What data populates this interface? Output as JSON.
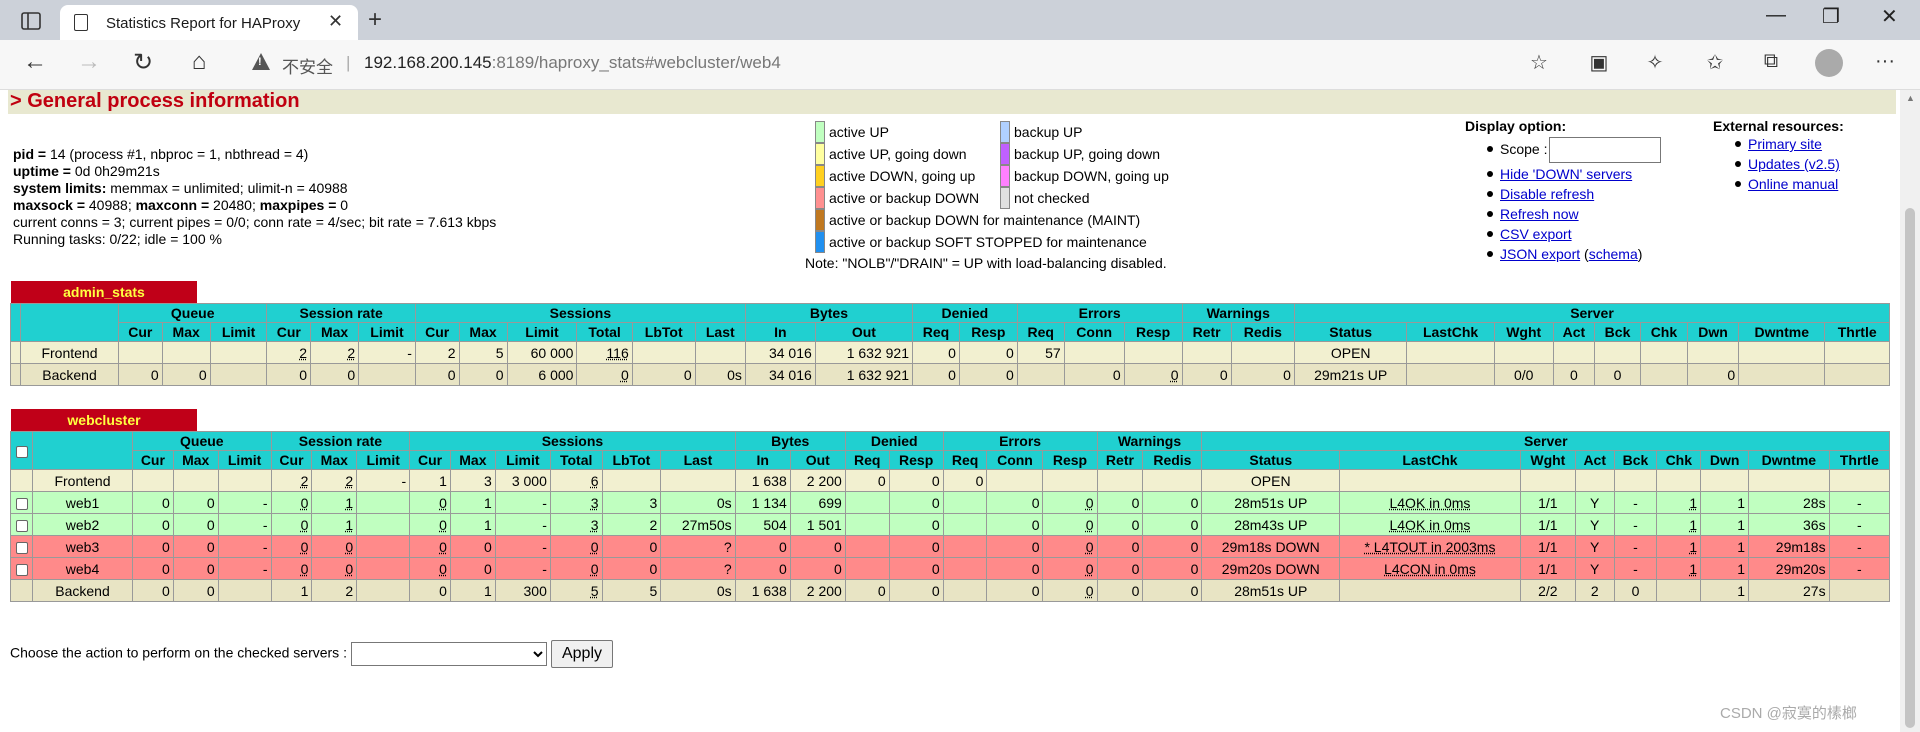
{
  "browser": {
    "tab_title": "Statistics Report for HAProxy",
    "insecure_label": "不安全",
    "url_host": "192.168.200.145",
    "url_rest": ":8189/haproxy_stats#webcluster/web4"
  },
  "page": {
    "section_title": "> General process information",
    "info": {
      "pid_label": "pid = ",
      "pid_value": "14 (process #1, nbproc = 1, nbthread = 4)",
      "uptime_label": "uptime = ",
      "uptime_value": "0d 0h29m21s",
      "limits_label": "system limits:",
      "limits_value": " memmax = unlimited; ulimit-n = 40988",
      "maxsock_label": "maxsock = ",
      "maxsock_value": "40988; ",
      "maxconn_label": "maxconn = ",
      "maxconn_value": "20480; ",
      "maxpipes_label": "maxpipes = ",
      "maxpipes_value": "0",
      "conns_line": "current conns = 3; current pipes = 0/0; conn rate = 4/sec; bit rate = 7.613 kbps",
      "tasks_line": "Running tasks: 0/22; idle = 100 %"
    },
    "legend": [
      {
        "label": "active UP",
        "color": "#c0ffc0"
      },
      {
        "label": "backup UP",
        "color": "#b0d0ff"
      },
      {
        "label": "active UP, going down",
        "color": "#ffffa0"
      },
      {
        "label": "backup UP, going down",
        "color": "#c060ff"
      },
      {
        "label": "active DOWN, going up",
        "color": "#ffd020"
      },
      {
        "label": "backup DOWN, going up",
        "color": "#ff80ff"
      },
      {
        "label": "active or backup DOWN",
        "color": "#ff9090"
      },
      {
        "label": "not checked",
        "color": "#e0e0e0"
      },
      {
        "label": "active or backup DOWN for maintenance (MAINT)",
        "color": "#c07820"
      },
      {
        "label": "active or backup SOFT STOPPED for maintenance",
        "color": "#2090f0"
      }
    ],
    "note": "Note: \"NOLB\"/\"DRAIN\" = UP with load-balancing disabled.",
    "display": {
      "title": "Display option:",
      "scope_label": "Scope :",
      "scope_value": "",
      "links": [
        "Hide 'DOWN' servers",
        "Disable refresh",
        "Refresh now",
        "CSV export",
        "JSON export"
      ],
      "schema_pre": " (",
      "schema": "schema",
      "schema_post": ")"
    },
    "external": {
      "title": "External resources:",
      "links": [
        "Primary site",
        "Updates (v2.5)",
        "Online manual"
      ]
    },
    "admin_stats": {
      "name": "admin_stats",
      "groups": [
        "Queue",
        "Session rate",
        "Sessions",
        "Bytes",
        "Denied",
        "Errors",
        "Warnings",
        "Server"
      ],
      "cols": [
        "Cur",
        "Max",
        "Limit",
        "Cur",
        "Max",
        "Limit",
        "Cur",
        "Max",
        "Limit",
        "Total",
        "LbTot",
        "Last",
        "In",
        "Out",
        "Req",
        "Resp",
        "Req",
        "Conn",
        "Resp",
        "Retr",
        "Redis",
        "Status",
        "LastChk",
        "Wght",
        "Act",
        "Bck",
        "Chk",
        "Dwn",
        "Dwntme",
        "Thrtle"
      ],
      "rows": [
        {
          "name": "Frontend",
          "cells": [
            "",
            "",
            "",
            "2",
            "2",
            "-",
            "2",
            "5",
            "60 000",
            "116",
            "",
            "",
            "34 016",
            "1 632 921",
            "0",
            "0",
            "57",
            "",
            "",
            "",
            "",
            "OPEN",
            "",
            "",
            "",
            "",
            "",
            "",
            "",
            ""
          ]
        },
        {
          "name": "Backend",
          "cells": [
            "0",
            "0",
            "",
            "0",
            "0",
            "",
            "0",
            "0",
            "6 000",
            "0",
            "0",
            "0s",
            "34 016",
            "1 632 921",
            "0",
            "0",
            "",
            "0",
            "0",
            "0",
            "0",
            "29m21s UP",
            "",
            "0/0",
            "0",
            "0",
            "",
            "0",
            "",
            ""
          ]
        }
      ]
    },
    "webcluster": {
      "name": "webcluster",
      "groups": [
        "Queue",
        "Session rate",
        "Sessions",
        "Bytes",
        "Denied",
        "Errors",
        "Warnings",
        "Server"
      ],
      "cols": [
        "Cur",
        "Max",
        "Limit",
        "Cur",
        "Max",
        "Limit",
        "Cur",
        "Max",
        "Limit",
        "Total",
        "LbTot",
        "Last",
        "In",
        "Out",
        "Req",
        "Resp",
        "Req",
        "Conn",
        "Resp",
        "Retr",
        "Redis",
        "Status",
        "LastChk",
        "Wght",
        "Act",
        "Bck",
        "Chk",
        "Dwn",
        "Dwntme",
        "Thrtle"
      ],
      "rows": [
        {
          "name": "Frontend",
          "kind": "front",
          "cells": [
            "",
            "",
            "",
            "2",
            "2",
            "-",
            "1",
            "3",
            "3 000",
            "6",
            "",
            "",
            "1 638",
            "2 200",
            "0",
            "0",
            "0",
            "",
            "",
            "",
            "",
            "OPEN",
            "",
            "",
            "",
            "",
            "",
            "",
            "",
            ""
          ]
        },
        {
          "name": "web1",
          "kind": "up",
          "cells": [
            "0",
            "0",
            "-",
            "0",
            "1",
            "",
            "0",
            "1",
            "-",
            "3",
            "3",
            "0s",
            "1 134",
            "699",
            "",
            "0",
            "",
            "0",
            "0",
            "0",
            "0",
            "28m51s UP",
            "L4OK in 0ms",
            "1/1",
            "Y",
            "-",
            "1",
            "1",
            "28s",
            "-"
          ]
        },
        {
          "name": "web2",
          "kind": "up",
          "cells": [
            "0",
            "0",
            "-",
            "0",
            "1",
            "",
            "0",
            "1",
            "-",
            "3",
            "2",
            "27m50s",
            "504",
            "1 501",
            "",
            "0",
            "",
            "0",
            "0",
            "0",
            "0",
            "28m43s UP",
            "L4OK in 0ms",
            "1/1",
            "Y",
            "-",
            "1",
            "1",
            "36s",
            "-"
          ]
        },
        {
          "name": "web3",
          "kind": "down",
          "cells": [
            "0",
            "0",
            "-",
            "0",
            "0",
            "",
            "0",
            "0",
            "-",
            "0",
            "0",
            "?",
            "0",
            "0",
            "",
            "0",
            "",
            "0",
            "0",
            "0",
            "0",
            "29m18s DOWN",
            "* L4TOUT in 2003ms",
            "1/1",
            "Y",
            "-",
            "1",
            "1",
            "29m18s",
            "-"
          ]
        },
        {
          "name": "web4",
          "kind": "down",
          "cells": [
            "0",
            "0",
            "-",
            "0",
            "0",
            "",
            "0",
            "0",
            "-",
            "0",
            "0",
            "?",
            "0",
            "0",
            "",
            "0",
            "",
            "0",
            "0",
            "0",
            "0",
            "29m20s DOWN",
            "L4CON in 0ms",
            "1/1",
            "Y",
            "-",
            "1",
            "1",
            "29m20s",
            "-"
          ]
        },
        {
          "name": "Backend",
          "kind": "back",
          "cells": [
            "0",
            "0",
            "",
            "1",
            "2",
            "",
            "0",
            "1",
            "300",
            "5",
            "5",
            "0s",
            "1 638",
            "2 200",
            "0",
            "0",
            "",
            "0",
            "0",
            "0",
            "0",
            "28m51s UP",
            "",
            "2/2",
            "2",
            "0",
            "",
            "1",
            "27s",
            ""
          ]
        }
      ]
    },
    "action_label": "Choose the action to perform on the checked servers :",
    "apply": "Apply",
    "watermark": "CSDN @寂寞的榡榔"
  }
}
